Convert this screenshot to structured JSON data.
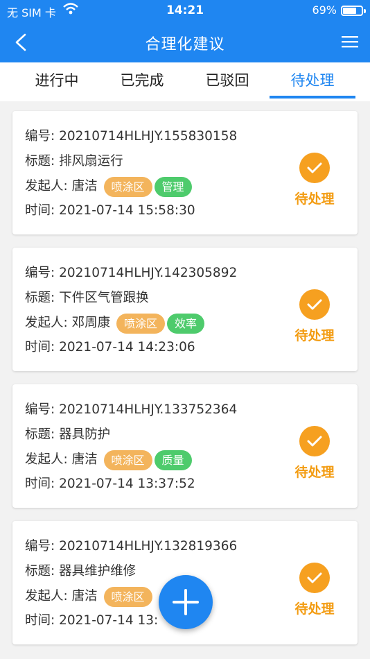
{
  "status_bar": {
    "carrier": "无 SIM 卡",
    "time": "14:21",
    "battery": "69%"
  },
  "nav": {
    "title": "合理化建议"
  },
  "tabs": [
    {
      "label": "进行中"
    },
    {
      "label": "已完成"
    },
    {
      "label": "已驳回"
    },
    {
      "label": "待处理"
    }
  ],
  "labels": {
    "id": "编号:",
    "title": "标题:",
    "initiator": "发起人:",
    "time": "时间:"
  },
  "cards": [
    {
      "id": "20210714HLHJY.155830158",
      "title": "排风扇运行",
      "initiator": "唐洁",
      "area": "喷涂区",
      "category": "管理",
      "time": "2021-07-14 15:58:30",
      "status": "待处理"
    },
    {
      "id": "20210714HLHJY.142305892",
      "title": "下件区气管跟换",
      "initiator": "邓周康",
      "area": "喷涂区",
      "category": "效率",
      "time": "2021-07-14 14:23:06",
      "status": "待处理"
    },
    {
      "id": "20210714HLHJY.133752364",
      "title": "器具防护",
      "initiator": "唐洁",
      "area": "喷涂区",
      "category": "质量",
      "time": "2021-07-14 13:37:52",
      "status": "待处理"
    },
    {
      "id": "20210714HLHJY.132819366",
      "title": "器具维护维修",
      "initiator": "唐洁",
      "area": "喷涂区",
      "category": "",
      "time": "2021-07-14 13:",
      "status": "待处理"
    }
  ],
  "colors": {
    "primary": "#1f86f1",
    "pending": "#f6a020",
    "area_tag": "#f3b45c",
    "category_tag": "#4ecb6c"
  },
  "icons": {
    "back": "chevron-left-icon",
    "menu": "hamburger-icon",
    "status": "check-circle-icon",
    "fab": "plus-icon"
  }
}
